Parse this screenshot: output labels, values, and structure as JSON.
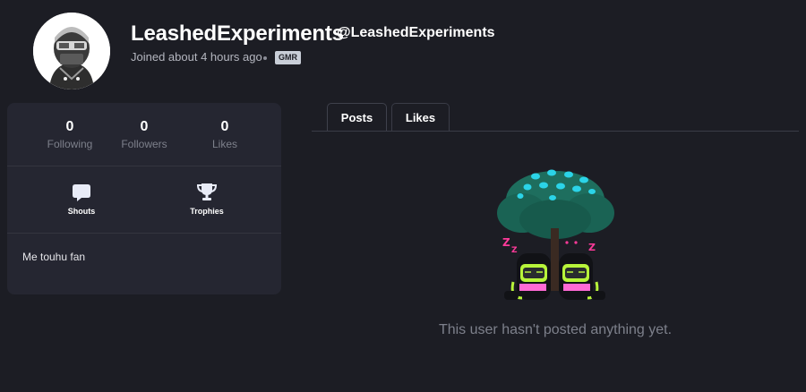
{
  "profile": {
    "display_name": "LeashedExperiments",
    "handle": "@LeashedExperiments",
    "joined": "Joined about 4 hours ago",
    "badge": "GMR",
    "bio": "Me touhu fan"
  },
  "stats": [
    {
      "value": "0",
      "label": "Following"
    },
    {
      "value": "0",
      "label": "Followers"
    },
    {
      "value": "0",
      "label": "Likes"
    }
  ],
  "links": [
    {
      "label": "Shouts",
      "icon": "speech-bubble-icon"
    },
    {
      "label": "Trophies",
      "icon": "trophy-icon"
    }
  ],
  "tabs": [
    {
      "label": "Posts",
      "active": true
    },
    {
      "label": "Likes",
      "active": false
    }
  ],
  "empty_state": {
    "message": "This user hasn't posted anything yet.",
    "illustration": "sleeping-creatures-under-tree",
    "sleep_letters": [
      "Z",
      "Z",
      "Z"
    ]
  },
  "colors": {
    "background": "#1c1d24",
    "card": "#252631",
    "badge": "#c9ced8",
    "tree": "#1e6e5e",
    "tree_spots": "#2bd4e8",
    "creature_accent": "#b8f53a",
    "sleep_z": "#ff3a9a"
  }
}
